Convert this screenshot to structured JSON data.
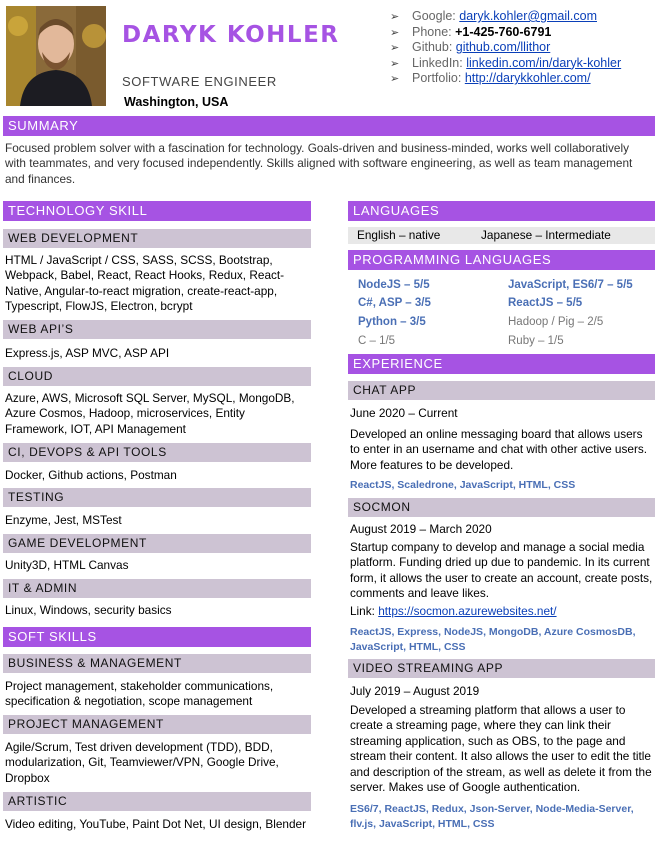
{
  "header": {
    "name": "DARYK KOHLER",
    "title": "SOFTWARE ENGINEER",
    "location": "Washington, USA"
  },
  "contacts": [
    {
      "label": "Google: ",
      "value": "daryk.kohler@gmail.com",
      "style": "link"
    },
    {
      "label": "Phone: ",
      "value": "+1-425-760-6791",
      "style": "bold"
    },
    {
      "label": "Github: ",
      "value": "github.com/llithor",
      "style": "link"
    },
    {
      "label": "LinkedIn: ",
      "value": "linkedin.com/in/daryk-kohler",
      "style": "link"
    },
    {
      "label": "Portfolio: ",
      "value": "http://darykkohler.com/",
      "style": "link"
    }
  ],
  "summary": {
    "heading": "SUMMARY",
    "text": "Focused problem solver with a fascination for technology. Goals-driven and business-minded, works well collaboratively with teammates, and very focused independently. Skills aligned with software engineering, as well as team management and finances."
  },
  "technology": {
    "heading": "TECHNOLOGY SKILL",
    "groups": [
      {
        "title": "WEB DEVELOPMENT",
        "text": "HTML / JavaScript / CSS, SASS, SCSS, Bootstrap, Webpack, Babel, React, React Hooks, Redux, React-Native, Angular-to-react migration, create-react-app, Typescript, FlowJS, Electron, bcrypt"
      },
      {
        "title": "WEB API’S",
        "text": "Express.js, ASP MVC, ASP API"
      },
      {
        "title": "CLOUD",
        "text": "Azure, AWS, Microsoft SQL Server, MySQL, MongoDB, Azure Cosmos, Hadoop, microservices, Entity Framework, IOT, API Management"
      },
      {
        "title": "CI, DEVOPS & API TOOLS",
        "text": "Docker, Github actions, Postman"
      },
      {
        "title": "TESTING",
        "text": "Enzyme, Jest, MSTest"
      },
      {
        "title": "GAME DEVELOPMENT",
        "text": "Unity3D, HTML Canvas"
      },
      {
        "title": "IT & ADMIN",
        "text": "Linux, Windows, security basics"
      }
    ]
  },
  "soft": {
    "heading": "SOFT SKILLS",
    "groups": [
      {
        "title": "BUSINESS & MANAGEMENT",
        "text": "Project management, stakeholder communications, specification & negotiation, scope management"
      },
      {
        "title": "PROJECT MANAGEMENT",
        "text": "Agile/Scrum, Test driven development (TDD), BDD, modularization, Git, Teamviewer/VPN, Google Drive, Dropbox"
      },
      {
        "title": "ARTISTIC",
        "text": "Video editing, YouTube, Paint Dot Net, UI design, Blender"
      }
    ]
  },
  "languages": {
    "heading": "LANGUAGES",
    "items": [
      "English – native",
      "Japanese – Intermediate"
    ]
  },
  "programming": {
    "heading": "PROGRAMMING LANGUAGES",
    "items": [
      {
        "text": "NodeJS – 5/5",
        "level": "strong"
      },
      {
        "text": "JavaScript, ES6/7 – 5/5",
        "level": "strong"
      },
      {
        "text": "C#, ASP – 3/5",
        "level": "strong"
      },
      {
        "text": "ReactJS – 5/5",
        "level": "strong"
      },
      {
        "text": "Python – 3/5",
        "level": "strong"
      },
      {
        "text": "Hadoop / Pig – 2/5",
        "level": "weak"
      },
      {
        "text": "C – 1/5",
        "level": "weak"
      },
      {
        "text": "Ruby – 1/5",
        "level": "weak"
      }
    ]
  },
  "experience": {
    "heading": "EXPERIENCE",
    "jobs": [
      {
        "title": "CHAT APP",
        "dates": "June 2020 – Current",
        "description": "Developed an online messaging board that allows users to enter in an username and chat with other active users. More features to be developed.",
        "tech": "ReactJS, Scaledrone, JavaScript, HTML, CSS"
      },
      {
        "title": "SOCMON",
        "dates": "August 2019 – March 2020",
        "description": "Startup company to develop and manage a social media platform. Funding dried up due to pandemic. In its current form, it allows the user to create an account, create posts, comments and leave likes.",
        "link_label": "Link: ",
        "link": "https://socmon.azurewebsites.net/",
        "tech": "ReactJS, Express, NodeJS, MongoDB, Azure CosmosDB, JavaScript, HTML, CSS"
      },
      {
        "title": "VIDEO STREAMING APP",
        "dates": "July 2019 – August 2019",
        "description": "Developed a streaming platform that allows a user to create a streaming page, where they can link their streaming application, such as OBS, to the page and stream their content. It also allows the user to edit the title and description of the stream, as well as delete it from the server. Makes use of Google authentication.",
        "tech": "ES6/7, ReactJS, Redux, Json-Server, Node-Media-Server, flv.js, JavaScript, HTML, CSS"
      }
    ]
  },
  "colors": {
    "accent": "#a653e3",
    "subheading_bg": "#cdc3d3",
    "tech_blue": "#4a6fb5",
    "link": "#0a3fb8"
  }
}
